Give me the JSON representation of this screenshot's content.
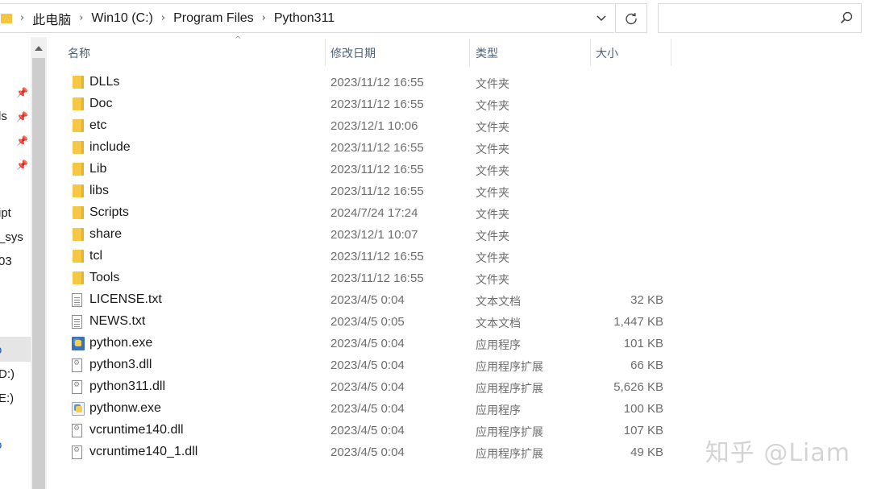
{
  "breadcrumb": [
    "此电脑",
    "Win10 (C:)",
    "Program Files",
    "Python311"
  ],
  "search": {
    "placeholder": ""
  },
  "nav": {
    "partial_items": [
      "ls",
      "ipt",
      "_sys",
      "03",
      "o",
      "D:)",
      "E:)",
      "o"
    ]
  },
  "columns": {
    "name": "名称",
    "date": "修改日期",
    "type": "类型",
    "size": "大小"
  },
  "files": [
    {
      "icon": "folder-icon",
      "name": "DLLs",
      "date": "2023/11/12 16:55",
      "type": "文件夹",
      "size": ""
    },
    {
      "icon": "folder-icon",
      "name": "Doc",
      "date": "2023/11/12 16:55",
      "type": "文件夹",
      "size": ""
    },
    {
      "icon": "folder-icon",
      "name": "etc",
      "date": "2023/12/1 10:06",
      "type": "文件夹",
      "size": ""
    },
    {
      "icon": "folder-icon",
      "name": "include",
      "date": "2023/11/12 16:55",
      "type": "文件夹",
      "size": ""
    },
    {
      "icon": "folder-icon",
      "name": "Lib",
      "date": "2023/11/12 16:55",
      "type": "文件夹",
      "size": ""
    },
    {
      "icon": "folder-icon",
      "name": "libs",
      "date": "2023/11/12 16:55",
      "type": "文件夹",
      "size": ""
    },
    {
      "icon": "folder-icon",
      "name": "Scripts",
      "date": "2024/7/24 17:24",
      "type": "文件夹",
      "size": ""
    },
    {
      "icon": "folder-icon",
      "name": "share",
      "date": "2023/12/1 10:07",
      "type": "文件夹",
      "size": ""
    },
    {
      "icon": "folder-icon",
      "name": "tcl",
      "date": "2023/11/12 16:55",
      "type": "文件夹",
      "size": ""
    },
    {
      "icon": "folder-icon",
      "name": "Tools",
      "date": "2023/11/12 16:55",
      "type": "文件夹",
      "size": ""
    },
    {
      "icon": "text-file-icon",
      "name": "LICENSE.txt",
      "date": "2023/4/5 0:04",
      "type": "文本文档",
      "size": "32 KB"
    },
    {
      "icon": "text-file-icon",
      "name": "NEWS.txt",
      "date": "2023/4/5 0:05",
      "type": "文本文档",
      "size": "1,447 KB"
    },
    {
      "icon": "python-exe-icon",
      "name": "python.exe",
      "date": "2023/4/5 0:04",
      "type": "应用程序",
      "size": "101 KB"
    },
    {
      "icon": "dll-file-icon",
      "name": "python3.dll",
      "date": "2023/4/5 0:04",
      "type": "应用程序扩展",
      "size": "66 KB"
    },
    {
      "icon": "dll-file-icon",
      "name": "python311.dll",
      "date": "2023/4/5 0:04",
      "type": "应用程序扩展",
      "size": "5,626 KB"
    },
    {
      "icon": "pythonw-exe-icon",
      "name": "pythonw.exe",
      "date": "2023/4/5 0:04",
      "type": "应用程序",
      "size": "100 KB"
    },
    {
      "icon": "dll-file-icon",
      "name": "vcruntime140.dll",
      "date": "2023/4/5 0:04",
      "type": "应用程序扩展",
      "size": "107 KB"
    },
    {
      "icon": "dll-file-icon",
      "name": "vcruntime140_1.dll",
      "date": "2023/4/5 0:04",
      "type": "应用程序扩展",
      "size": "49 KB"
    }
  ],
  "watermark": "知乎 @Liam",
  "colors": {
    "folder": "#f6c744",
    "header_text": "#4c607a",
    "meta_text": "#6d6d6d"
  }
}
